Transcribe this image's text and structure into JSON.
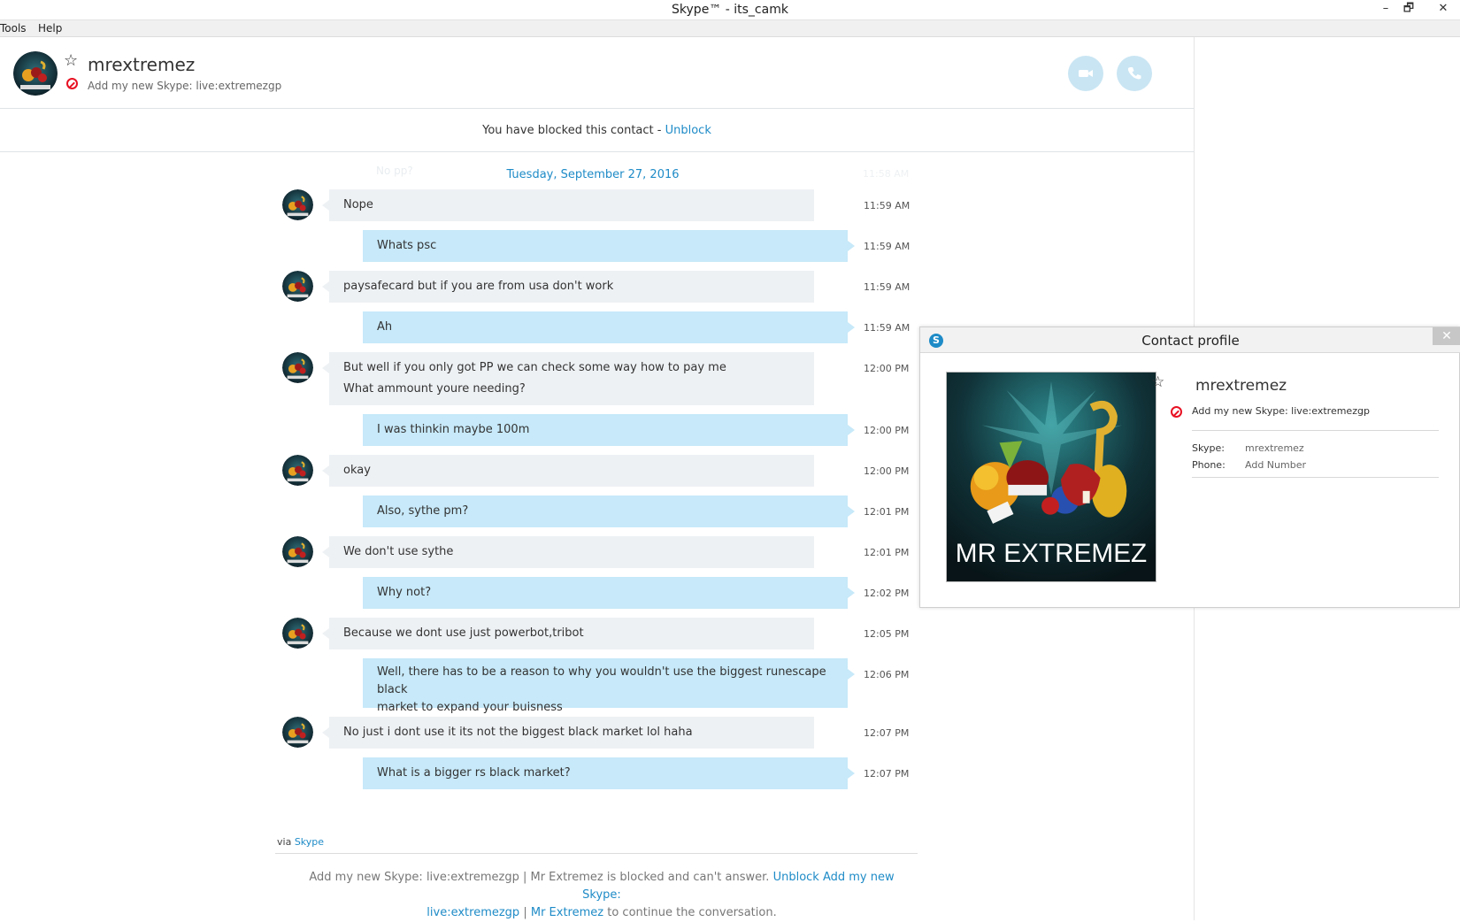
{
  "window": {
    "title": "Skype™ - its_camk",
    "min": "–",
    "max": "🗗",
    "close": "✕"
  },
  "menu": {
    "tools": "Tools",
    "help": "Help"
  },
  "header": {
    "name": "mrextremez",
    "mood": "Add my new Skype: live:extremezgp"
  },
  "banner": {
    "text": "You have blocked this contact - ",
    "link": "Unblock"
  },
  "conversation": {
    "date": "Tuesday, September 27, 2016",
    "ghost_text": "No pp?",
    "ghost_time": "11:58 AM",
    "messages": [
      {
        "dir": "in",
        "lines": [
          "Nope"
        ],
        "time": "11:59 AM"
      },
      {
        "dir": "out",
        "lines": [
          "Whats psc"
        ],
        "time": "11:59 AM"
      },
      {
        "dir": "in",
        "lines": [
          "paysafecard but if you are from usa don't work"
        ],
        "time": "11:59 AM"
      },
      {
        "dir": "out",
        "lines": [
          "Ah"
        ],
        "time": "11:59 AM"
      },
      {
        "dir": "in",
        "lines": [
          "But well if you only got PP we can check some way how to pay me",
          "What ammount youre needing?"
        ],
        "time": "12:00 PM"
      },
      {
        "dir": "out",
        "lines": [
          "I was thinkin maybe 100m"
        ],
        "time": "12:00 PM"
      },
      {
        "dir": "in",
        "lines": [
          "okay"
        ],
        "time": "12:00 PM"
      },
      {
        "dir": "out",
        "lines": [
          "Also, sythe pm?"
        ],
        "time": "12:01 PM"
      },
      {
        "dir": "in",
        "lines": [
          "We don't use sythe"
        ],
        "time": "12:01 PM"
      },
      {
        "dir": "out",
        "lines": [
          "Why not?"
        ],
        "time": "12:02 PM"
      },
      {
        "dir": "in",
        "lines": [
          "Because we dont use just powerbot,tribot"
        ],
        "time": "12:05 PM"
      },
      {
        "dir": "out",
        "lines": [
          "Well, there has to be a reason to why you wouldn't use the biggest runescape black",
          "market to expand your buisness"
        ],
        "time": "12:06 PM"
      },
      {
        "dir": "in",
        "lines": [
          "No just i dont use it its not the biggest black market lol haha"
        ],
        "time": "12:07 PM"
      },
      {
        "dir": "out",
        "lines": [
          "What is a bigger rs black market?"
        ],
        "time": "12:07 PM"
      }
    ]
  },
  "footer": {
    "via_label": "via",
    "via_link": "Skype",
    "blocked_text_1": "Add my new Skype: live:extremezgp | Mr Extremez is blocked and can't answer.",
    "blocked_link_1": "Unblock Add my new Skype:",
    "blocked_link_2": "live:extremezgp",
    "blocked_sep": "|",
    "blocked_link_3": "Mr Extremez",
    "blocked_text_2": "to continue the conversation."
  },
  "profile": {
    "title": "Contact profile",
    "name": "mrextremez",
    "mood": "Add my new Skype: live:extremezgp",
    "image_caption": "MR EXTREMEZ",
    "skype_label": "Skype:",
    "skype_value": "mrextremez",
    "phone_label": "Phone:",
    "phone_value": "Add Number"
  },
  "colors": {
    "accent": "#1e8bc7",
    "incoming_bubble": "#eef1f4",
    "outgoing_bubble": "#c7e9f9",
    "call_button": "#c9e5f3",
    "blocked_red": "#e81123"
  }
}
